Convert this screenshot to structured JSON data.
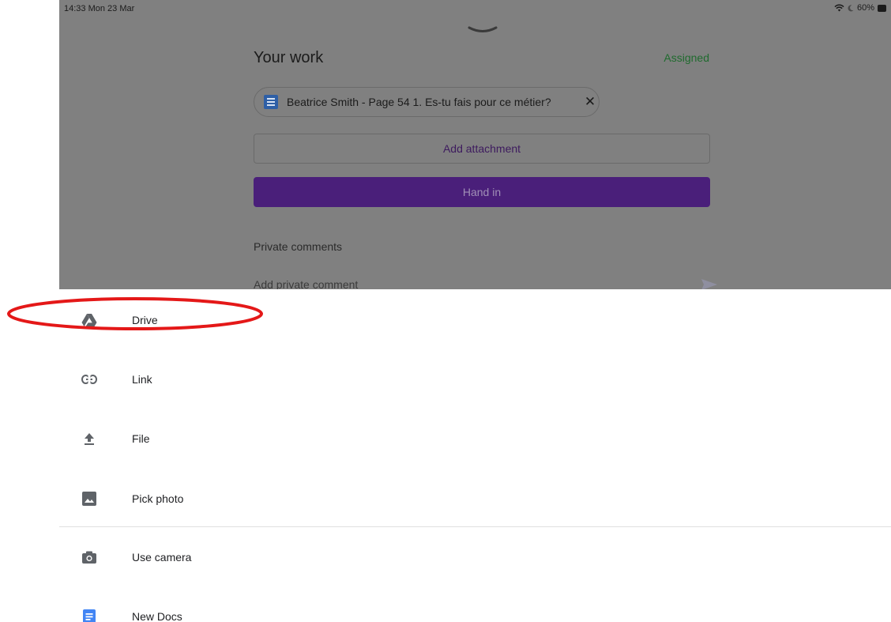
{
  "status_bar": {
    "time": "14:33  Mon 23 Mar",
    "battery": "60%"
  },
  "assignment": {
    "title": "Your work",
    "status": "Assigned",
    "attachment": "Beatrice Smith - Page 54 1. Es-tu fais pour ce métier?",
    "add_attachment_label": "Add attachment",
    "hand_in_label": "Hand in",
    "private_comments_title": "Private comments",
    "comment_placeholder": "Add private comment"
  },
  "menu": {
    "items": [
      {
        "label": "Drive",
        "icon": "drive-icon"
      },
      {
        "label": "Link",
        "icon": "link-icon"
      },
      {
        "label": "File",
        "icon": "upload-icon"
      },
      {
        "label": "Pick photo",
        "icon": "photo-icon"
      },
      {
        "label": "Use camera",
        "icon": "camera-icon"
      },
      {
        "label": "New Docs",
        "icon": "docs-icon"
      }
    ]
  },
  "colors": {
    "accent": "#4a1f7a",
    "assigned": "#1f6b2e",
    "annotation": "#e41818",
    "docs_blue": "#4285f4"
  }
}
